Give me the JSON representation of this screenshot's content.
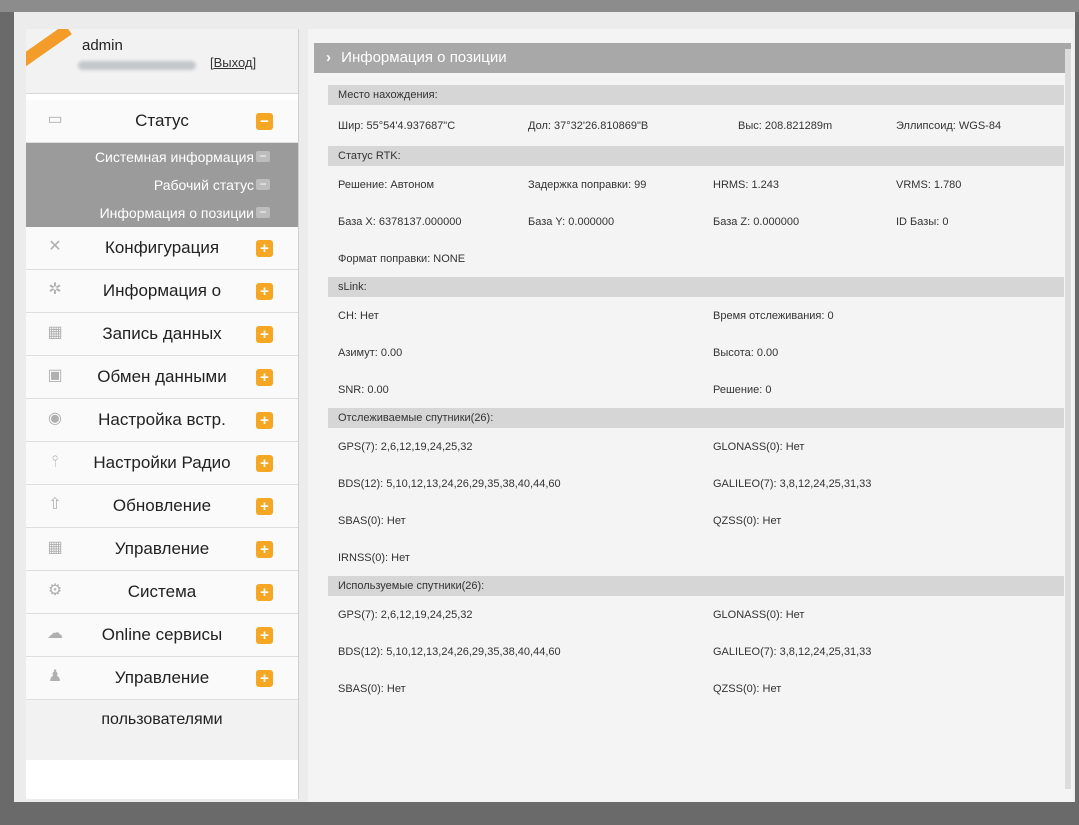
{
  "user": {
    "name": "admin",
    "logout": "[Выход]"
  },
  "menu": [
    {
      "label": "Статус",
      "icon": "monitor-icon",
      "expand": "−"
    },
    {
      "label": "Конфигурация",
      "icon": "tools-icon",
      "expand": "+"
    },
    {
      "label": "Информация о",
      "icon": "satellite-icon",
      "expand": "+"
    },
    {
      "label": "Запись данных",
      "icon": "calendar-icon",
      "expand": "+"
    },
    {
      "label": "Обмен данными",
      "icon": "exchange-icon",
      "expand": "+"
    },
    {
      "label": "Настройка встр.",
      "icon": "settings-icon",
      "expand": "+"
    },
    {
      "label": "Настройки Радио",
      "icon": "antenna-icon",
      "expand": "+"
    },
    {
      "label": "Обновление",
      "icon": "upload-icon",
      "expand": "+"
    },
    {
      "label": "Управление",
      "icon": "calendar-icon",
      "expand": "+"
    },
    {
      "label": "Система",
      "icon": "gear-icon",
      "expand": "+"
    },
    {
      "label": "Online сервисы",
      "icon": "cloud-icon",
      "expand": "+"
    },
    {
      "label": "Управление",
      "icon": "users-icon",
      "expand": "+"
    }
  ],
  "menu_extra": "пользователями",
  "submenu": [
    {
      "label": "Системная информация"
    },
    {
      "label": "Рабочий статус"
    },
    {
      "label": "Информация о позиции"
    }
  ],
  "page": {
    "title": "Информация о позиции",
    "sec_location": "Место нахождения:",
    "lat": "Шир:  55°54'4.937687\"C",
    "lon": "Дол:  37°32'26.810869\"B",
    "alt": "Выс:  208.821289m",
    "ellipsoid": "Эллипсоид:  WGS-84",
    "sec_rtk": "Статус RTK:",
    "solution": "Решение:  Автоном",
    "corr_delay": "Задержка поправки:  99",
    "hrms": "HRMS:  1.243",
    "vrms": "VRMS:  1.780",
    "base_x": "База X:  6378137.000000",
    "base_y": "База Y:  0.000000",
    "base_z": "База Z:  0.000000",
    "base_id": "ID Базы:  0",
    "corr_format": "Формат поправки:  NONE",
    "sec_slink": "sLink:",
    "ch": "CH:  Нет",
    "track_time": "Время отслеживания:  0",
    "azimuth": "Азимут:  0.00",
    "height": "Высота:  0.00",
    "snr": "SNR:  0.00",
    "slink_solution": "Решение:  0",
    "sec_tracked": "Отслеживаемые спутники(26):",
    "t_gps": "GPS(7):  2,6,12,19,24,25,32",
    "t_glonass": "GLONASS(0):  Нет",
    "t_bds": "BDS(12):  5,10,12,13,24,26,29,35,38,40,44,60",
    "t_galileo": "GALILEO(7):  3,8,12,24,25,31,33",
    "t_sbas": "SBAS(0):  Нет",
    "t_qzss": "QZSS(0):  Нет",
    "t_irnss": "IRNSS(0):  Нет",
    "sec_used": "Используемые спутники(26):",
    "u_gps": "GPS(7):  2,6,12,19,24,25,32",
    "u_glonass": "GLONASS(0):  Нет",
    "u_bds": "BDS(12):  5,10,12,13,24,26,29,35,38,40,44,60",
    "u_galileo": "GALILEO(7):  3,8,12,24,25,31,33",
    "u_sbas": "SBAS(0):  Нет",
    "u_qzss": "QZSS(0):  Нет"
  },
  "colors": {
    "accent": "#f5a623",
    "submenu": "#9b9b9b",
    "header": "#a8a8a8",
    "section": "#d6d6d6"
  }
}
